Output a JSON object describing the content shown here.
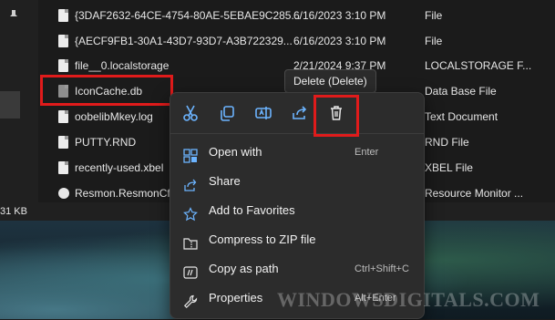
{
  "explorer": {
    "files": [
      {
        "name": "{3DAF2632-64CE-4754-80AE-5EBAE9C285...",
        "date": "6/16/2023 3:10 PM",
        "type": "File",
        "icon": "file-icon"
      },
      {
        "name": "{AECF9FB1-30A1-43D7-93D7-A3B722329...",
        "date": "6/16/2023 3:10 PM",
        "type": "File",
        "icon": "file-icon"
      },
      {
        "name": "file__0.localstorage",
        "date": "2/21/2024 9:37 PM",
        "type": "LOCALSTORAGE F...",
        "icon": "file-icon"
      },
      {
        "name": "IconCache.db",
        "date": "",
        "type": "Data Base File",
        "icon": "database-file-icon"
      },
      {
        "name": "oobelibMkey.log",
        "date": "",
        "type": "Text Document",
        "icon": "file-icon"
      },
      {
        "name": "PUTTY.RND",
        "date": "",
        "type": "RND File",
        "icon": "file-icon"
      },
      {
        "name": "recently-used.xbel",
        "date": "",
        "type": "XBEL File",
        "icon": "file-icon"
      },
      {
        "name": "Resmon.ResmonCfg",
        "date": "",
        "type": "Resource Monitor ...",
        "icon": "resmon-file-icon"
      }
    ],
    "status_size": "31 KB"
  },
  "tooltip": {
    "text": "Delete (Delete)"
  },
  "context_menu": {
    "toolbar": [
      {
        "name": "cut-button",
        "icon": "scissors-icon"
      },
      {
        "name": "copy-button",
        "icon": "copy-icon"
      },
      {
        "name": "rename-button",
        "icon": "rename-icon"
      },
      {
        "name": "share-toolbar-button",
        "icon": "share-icon"
      },
      {
        "name": "delete-button",
        "icon": "trash-icon"
      }
    ],
    "items": [
      {
        "label": "Open with",
        "shortcut": "Enter",
        "icon": "open-with-icon"
      },
      {
        "label": "Share",
        "shortcut": "",
        "icon": "share-icon"
      },
      {
        "label": "Add to Favorites",
        "shortcut": "",
        "icon": "star-icon"
      },
      {
        "label": "Compress to ZIP file",
        "shortcut": "",
        "icon": "zip-folder-icon"
      },
      {
        "label": "Copy as path",
        "shortcut": "Ctrl+Shift+C",
        "icon": "copy-path-icon"
      },
      {
        "label": "Properties",
        "shortcut": "Alt+Enter",
        "icon": "wrench-icon"
      }
    ]
  },
  "watermark": {
    "text": "WINDOWSDIGITALS.COM"
  },
  "colors": {
    "highlight": "#e01b1b",
    "icon_blue": "#6cb4ff",
    "menu_bg": "#2c2c2c"
  }
}
